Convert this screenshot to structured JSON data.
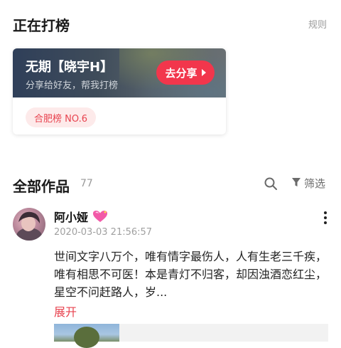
{
  "header": {
    "title": "正在打榜",
    "rules_label": "规则"
  },
  "rank_card": {
    "title": "无期【晓宇H】",
    "subtitle": "分享给好友，帮我打榜",
    "share_label": "去分享",
    "rank_badge": "合肥榜 NO.6"
  },
  "works": {
    "title": "全部作品",
    "count": "77",
    "filter_label": "筛选"
  },
  "post": {
    "username": "阿小娅",
    "timestamp": "2020-03-03 21:56:57",
    "text": "世间文字八万个，唯有情字最伤人，人有生老三千疾，唯有相思不可医！本是青灯不归客，却因浊酒恋红尘，星空不问赶路人，岁...",
    "expand_label": "展开"
  },
  "colors": {
    "accent": "#f2364c",
    "badge_bg": "#fdeaea",
    "muted": "#9a9a9a"
  },
  "icons": [
    "search-icon",
    "filter-icon",
    "more-icon",
    "sparkle-heart-icon",
    "play-triangle-icon"
  ]
}
